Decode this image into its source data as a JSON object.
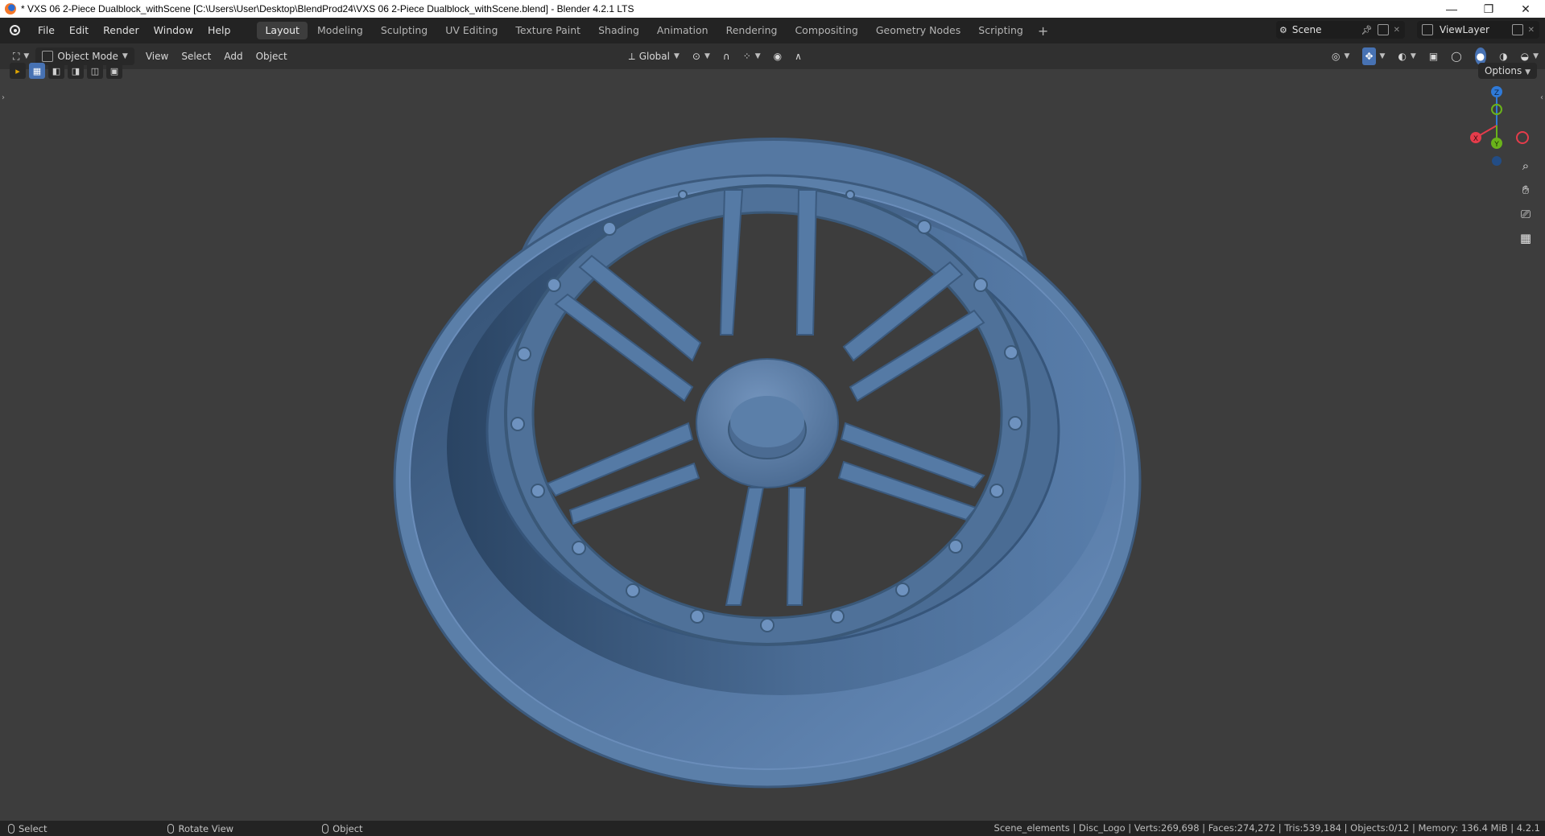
{
  "window": {
    "title": "* VXS 06 2-Piece Dualblock_withScene [C:\\Users\\User\\Desktop\\BlendProd24\\VXS 06 2-Piece Dualblock_withScene.blend] - Blender 4.2.1 LTS",
    "controls": {
      "minimize": "—",
      "maximize": "❐",
      "close": "✕"
    }
  },
  "menu": {
    "items": [
      "File",
      "Edit",
      "Render",
      "Window",
      "Help"
    ]
  },
  "workspaces": {
    "tabs": [
      "Layout",
      "Modeling",
      "Sculpting",
      "UV Editing",
      "Texture Paint",
      "Shading",
      "Animation",
      "Rendering",
      "Compositing",
      "Geometry Nodes",
      "Scripting"
    ],
    "active": "Layout",
    "add": "+"
  },
  "scene": {
    "name": "Scene",
    "view_layer": "ViewLayer"
  },
  "header": {
    "mode": "Object Mode",
    "menus": [
      "View",
      "Select",
      "Add",
      "Object"
    ],
    "transform_orientation": "Global",
    "options": "Options"
  },
  "gizmo": {
    "x": "X",
    "y": "Y",
    "z": "Z",
    "colors": {
      "x": "#e53c4b",
      "y": "#6ab31a",
      "z": "#2f7ad8"
    }
  },
  "viewport": {
    "background": "#3d3d3d",
    "model_color": "#5a7fa8"
  },
  "status": {
    "hints": [
      "Select",
      "Rotate View",
      "Object"
    ],
    "stats": "Scene_elements | Disc_Logo | Verts:269,698 | Faces:274,272 | Tris:539,184 | Objects:0/12 | Memory: 136.4 MiB | 4.2.1"
  }
}
